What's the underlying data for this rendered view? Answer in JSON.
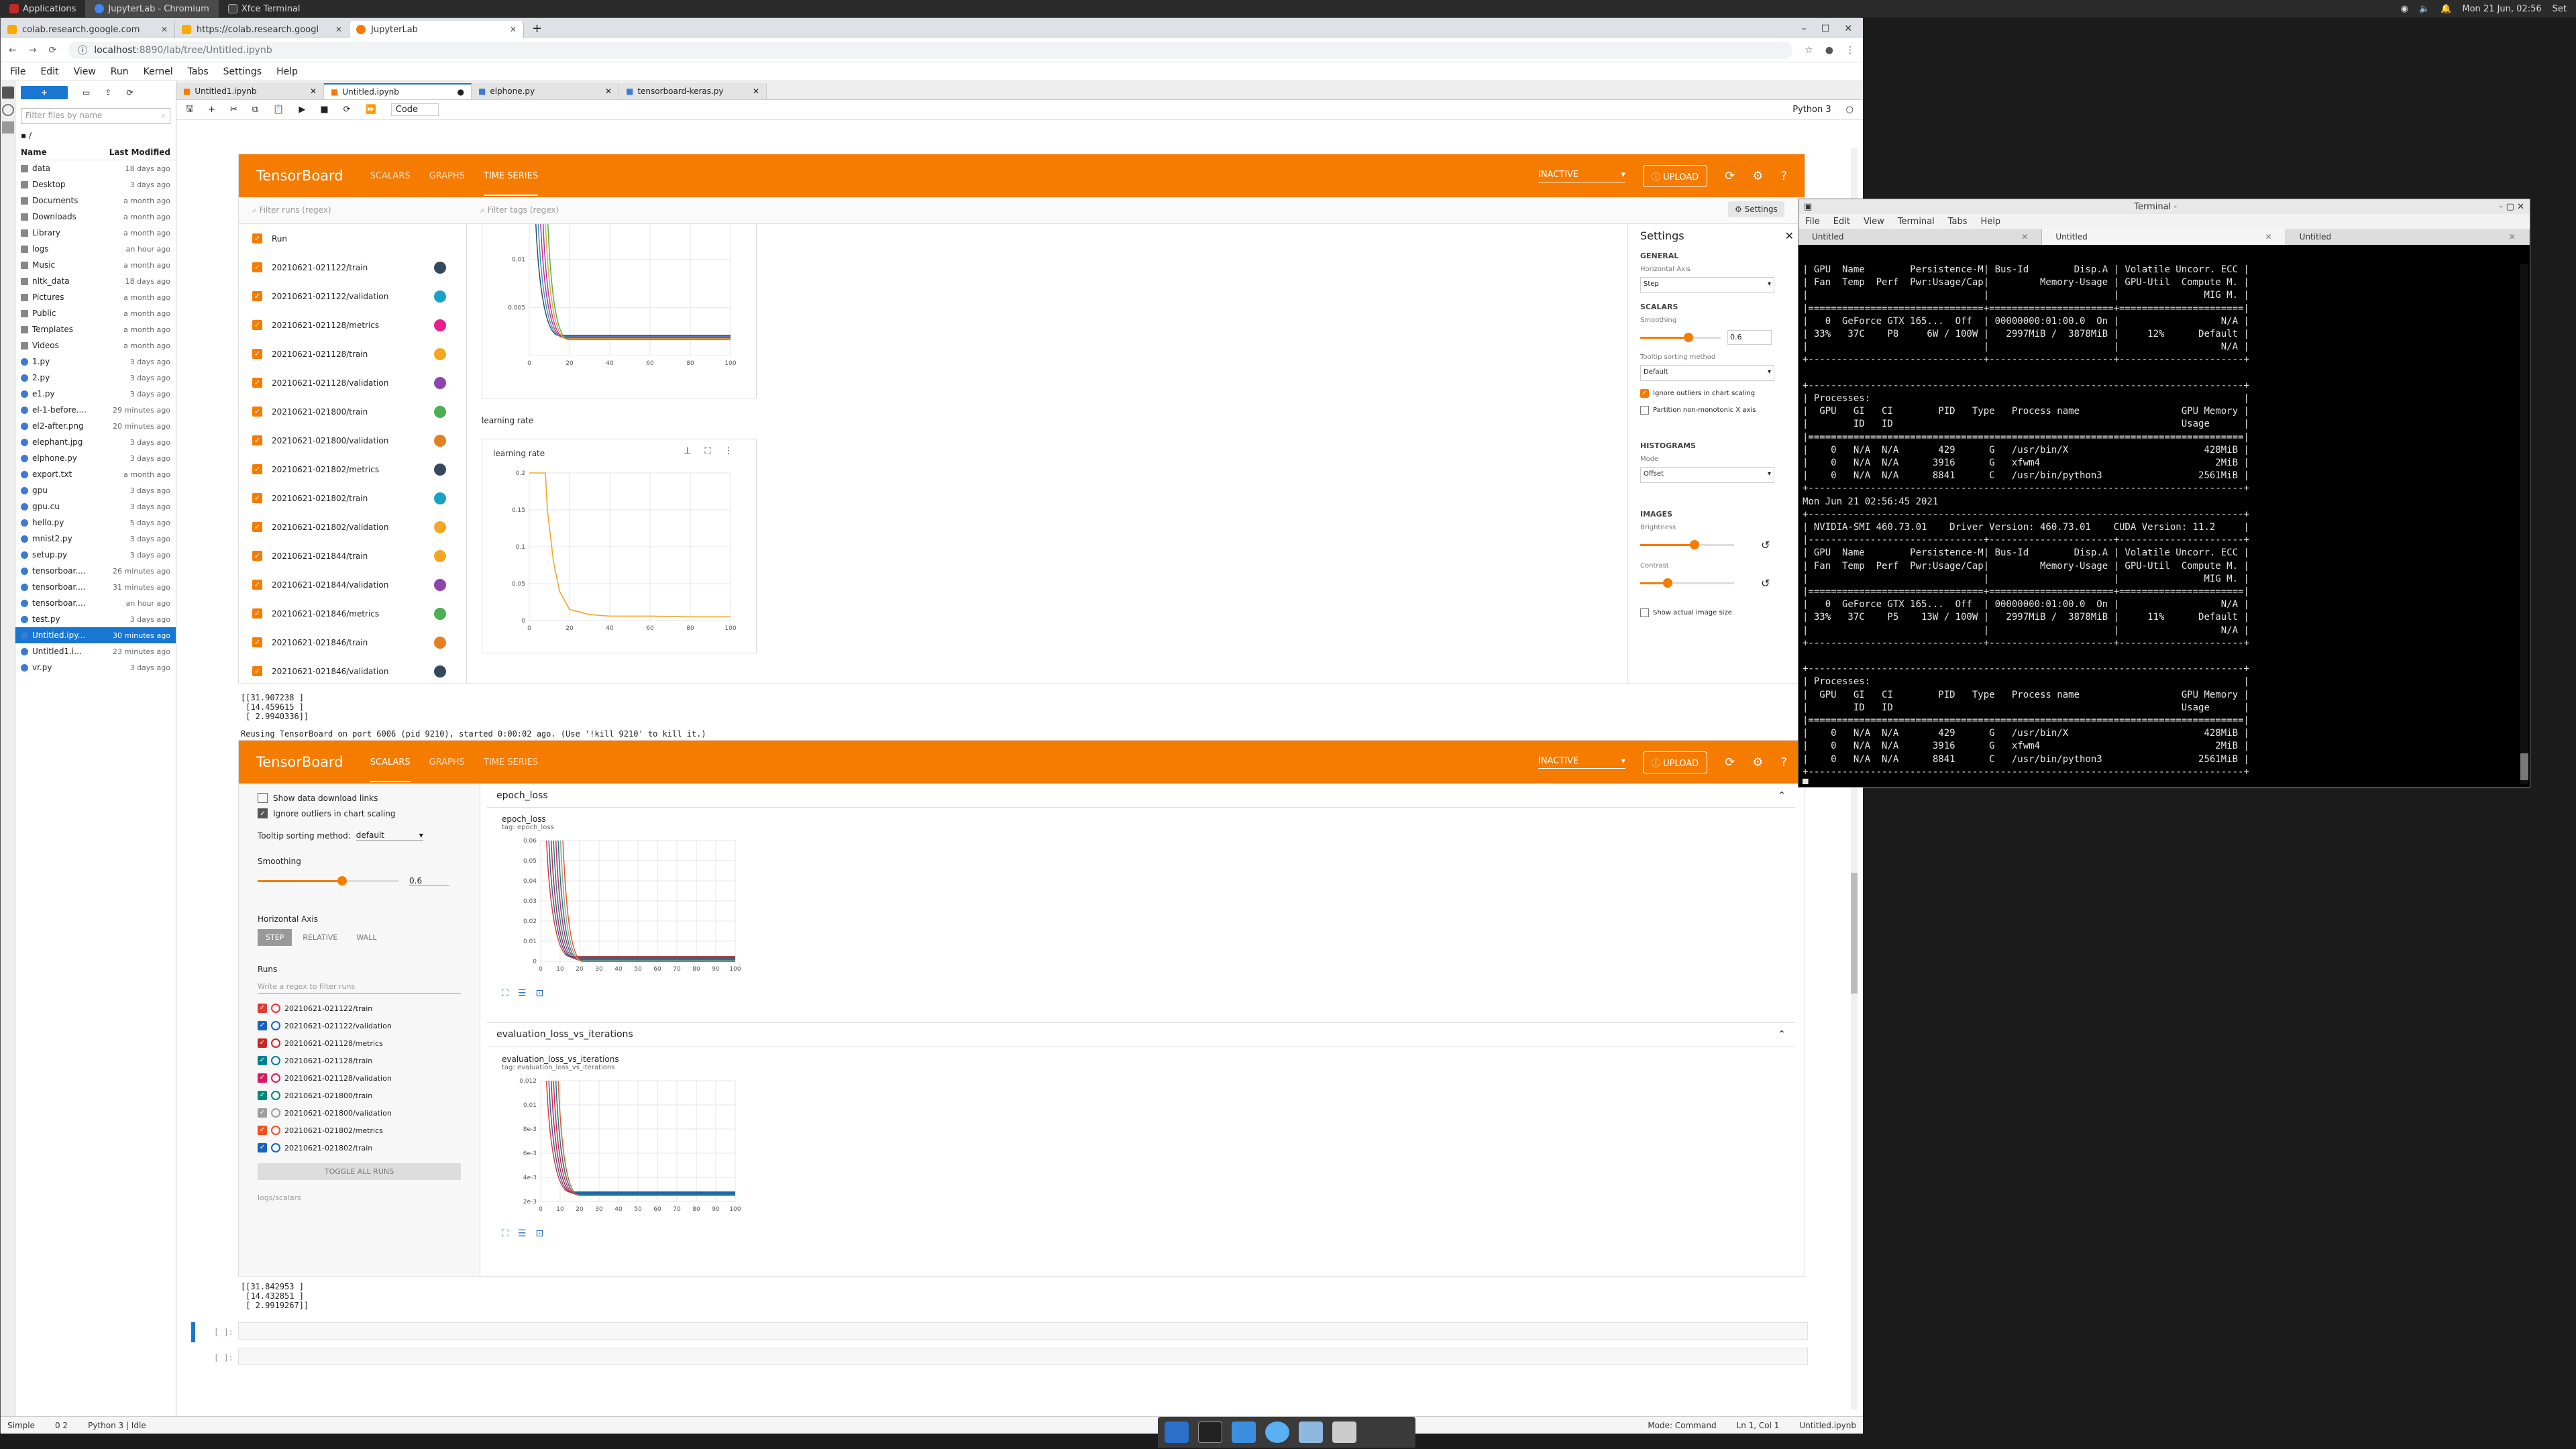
{
  "topbar": {
    "items": [
      "Applications",
      "JupyterLab - Chromium",
      "Xfce Terminal"
    ],
    "clock": "Mon 21 Jun, 02:56",
    "user": "Set"
  },
  "browser": {
    "tabs": [
      {
        "label": "colab.research.google.com"
      },
      {
        "label": "https://colab.research.googl"
      },
      {
        "label": "JupyterLab"
      }
    ],
    "url_host": "localhost",
    "url_path": ":8890/lab/tree/Untitled.ipynb"
  },
  "jupyter": {
    "menu": [
      "File",
      "Edit",
      "View",
      "Run",
      "Kernel",
      "Tabs",
      "Settings",
      "Help"
    ],
    "filter_placeholder": "Filter files by name",
    "path": "/",
    "col_name": "Name",
    "col_modified": "Last Modified",
    "files": [
      {
        "name": "data",
        "date": "18 days ago",
        "type": "folder"
      },
      {
        "name": "Desktop",
        "date": "3 days ago",
        "type": "folder"
      },
      {
        "name": "Documents",
        "date": "a month ago",
        "type": "folder"
      },
      {
        "name": "Downloads",
        "date": "a month ago",
        "type": "folder"
      },
      {
        "name": "Library",
        "date": "a month ago",
        "type": "folder"
      },
      {
        "name": "logs",
        "date": "an hour ago",
        "type": "folder"
      },
      {
        "name": "Music",
        "date": "a month ago",
        "type": "folder"
      },
      {
        "name": "nltk_data",
        "date": "18 days ago",
        "type": "folder"
      },
      {
        "name": "Pictures",
        "date": "a month ago",
        "type": "folder"
      },
      {
        "name": "Public",
        "date": "a month ago",
        "type": "folder"
      },
      {
        "name": "Templates",
        "date": "a month ago",
        "type": "folder"
      },
      {
        "name": "Videos",
        "date": "a month ago",
        "type": "folder"
      },
      {
        "name": "1.py",
        "date": "3 days ago",
        "type": "file"
      },
      {
        "name": "2.py",
        "date": "3 days ago",
        "type": "file"
      },
      {
        "name": "e1.py",
        "date": "3 days ago",
        "type": "file"
      },
      {
        "name": "el-1-before....",
        "date": "29 minutes ago",
        "type": "file"
      },
      {
        "name": "el2-after.png",
        "date": "20 minutes ago",
        "type": "file"
      },
      {
        "name": "elephant.jpg",
        "date": "3 days ago",
        "type": "file"
      },
      {
        "name": "elphone.py",
        "date": "3 days ago",
        "type": "file"
      },
      {
        "name": "export.txt",
        "date": "a month ago",
        "type": "file"
      },
      {
        "name": "gpu",
        "date": "3 days ago",
        "type": "file"
      },
      {
        "name": "gpu.cu",
        "date": "3 days ago",
        "type": "file"
      },
      {
        "name": "hello.py",
        "date": "5 days ago",
        "type": "file"
      },
      {
        "name": "mnist2.py",
        "date": "3 days ago",
        "type": "file"
      },
      {
        "name": "setup.py",
        "date": "3 days ago",
        "type": "file"
      },
      {
        "name": "tensorboar....",
        "date": "26 minutes ago",
        "type": "file"
      },
      {
        "name": "tensorboar....",
        "date": "31 minutes ago",
        "type": "file"
      },
      {
        "name": "tensorboar....",
        "date": "an hour ago",
        "type": "file"
      },
      {
        "name": "test.py",
        "date": "3 days ago",
        "type": "file"
      },
      {
        "name": "Untitled.ipy...",
        "date": "30 minutes ago",
        "type": "file",
        "selected": true
      },
      {
        "name": "Untitled1.i...",
        "date": "23 minutes ago",
        "type": "file"
      },
      {
        "name": "vr.py",
        "date": "3 days ago",
        "type": "file"
      }
    ],
    "doc_tabs": [
      "Untitled1.ipynb",
      "Untitled.ipynb",
      "elphone.py",
      "tensorboard-keras.py"
    ],
    "cell_type": "Code",
    "kernel": "Python 3",
    "status": {
      "mode": "Simple",
      "counts": "0  2",
      "kernel_state": "Python 3 | Idle",
      "mode_cmd": "Mode: Command",
      "cursor": "Ln 1, Col 1",
      "file": "Untitled.ipynb"
    }
  },
  "tb1": {
    "title": "TensorBoard",
    "nav": [
      "SCALARS",
      "GRAPHS",
      "TIME SERIES"
    ],
    "active_nav": "TIME SERIES",
    "inactive": "INACTIVE",
    "upload": "UPLOAD",
    "filter_runs": "Filter runs (regex)",
    "filter_tags": "Filter tags (regex)",
    "settings_btn": "Settings",
    "runs_header": "Run",
    "runs": [
      {
        "name": "20210621-021122/train",
        "color": "#34495e"
      },
      {
        "name": "20210621-021122/validation",
        "color": "#1ba1c6"
      },
      {
        "name": "20210621-021128/metrics",
        "color": "#e91e8c"
      },
      {
        "name": "20210621-021128/train",
        "color": "#f5a623"
      },
      {
        "name": "20210621-021128/validation",
        "color": "#8e44ad"
      },
      {
        "name": "20210621-021800/train",
        "color": "#4caf50"
      },
      {
        "name": "20210621-021800/validation",
        "color": "#e67e22"
      },
      {
        "name": "20210621-021802/metrics",
        "color": "#34495e"
      },
      {
        "name": "20210621-021802/train",
        "color": "#1ba1c6"
      },
      {
        "name": "20210621-021802/validation",
        "color": "#f5a623"
      },
      {
        "name": "20210621-021844/train",
        "color": "#f5a623"
      },
      {
        "name": "20210621-021844/validation",
        "color": "#8e44ad"
      },
      {
        "name": "20210621-021846/metrics",
        "color": "#4caf50"
      },
      {
        "name": "20210621-021846/train",
        "color": "#e67e22"
      },
      {
        "name": "20210621-021846/validation",
        "color": "#34495e"
      }
    ],
    "group_label": "learning rate",
    "card_title": "learning rate",
    "settings": {
      "title": "Settings",
      "general": "GENERAL",
      "h_axis": "Horizontal Axis",
      "h_axis_val": "Step",
      "scalars": "SCALARS",
      "smoothing": "Smoothing",
      "smoothing_val": "0.6",
      "smoothing_level": 0.6,
      "tooltip": "Tooltip sorting method",
      "tooltip_val": "Default",
      "ignore_outliers": "Ignore outliers in chart scaling",
      "partition": "Partition non-monotonic X axis",
      "histograms": "HISTOGRAMS",
      "mode": "Mode",
      "mode_val": "Offset",
      "images": "IMAGES",
      "brightness": "Brightness",
      "contrast": "Contrast",
      "show_actual": "Show actual image size"
    }
  },
  "output1": [
    "[[31.907238 ]",
    " [14.459615 ]",
    " [ 2.9940336]]"
  ],
  "reuse_msg": "Reusing TensorBoard on port 6006 (pid 9210), started 0:00:02 ago. (Use '!kill 9210' to kill it.)",
  "tb2": {
    "title": "TensorBoard",
    "nav": [
      "SCALARS",
      "GRAPHS",
      "TIME SERIES"
    ],
    "active_nav": "SCALARS",
    "inactive": "INACTIVE",
    "upload": "UPLOAD",
    "show_download": "Show data download links",
    "ignore_outliers": "Ignore outliers in chart scaling",
    "tooltip_label": "Tooltip sorting method:",
    "tooltip_val": "default",
    "smoothing": "Smoothing",
    "smoothing_val": "0.6",
    "smoothing_level": 0.6,
    "h_axis": "Horizontal Axis",
    "h_opts": [
      "STEP",
      "RELATIVE",
      "WALL"
    ],
    "runs_label": "Runs",
    "runs_filter": "Write a regex to filter runs",
    "runs": [
      {
        "name": "20210621-021122/train",
        "color": "#e53935"
      },
      {
        "name": "20210621-021122/validation",
        "color": "#1565c0"
      },
      {
        "name": "20210621-021128/metrics",
        "color": "#c62828"
      },
      {
        "name": "20210621-021128/train",
        "color": "#00838f"
      },
      {
        "name": "20210621-021128/validation",
        "color": "#d81b60"
      },
      {
        "name": "20210621-021800/train",
        "color": "#00897b"
      },
      {
        "name": "20210621-021800/validation",
        "color": "#9e9e9e"
      },
      {
        "name": "20210621-021802/metrics",
        "color": "#f4511e"
      },
      {
        "name": "20210621-021802/train",
        "color": "#1565c0"
      }
    ],
    "toggle_all": "TOGGLE ALL RUNS",
    "logdir": "logs/scalars",
    "sec1": "epoch_loss",
    "chart1_title": "epoch_loss",
    "chart1_tag": "tag: epoch_loss",
    "sec2": "evaluation_loss_vs_iterations",
    "chart2_title": "evaluation_loss_vs_iterations",
    "chart2_tag": "tag: evaluation_loss_vs_iterations"
  },
  "output2": [
    "[[31.842953 ]",
    " [14.432851 ]",
    " [ 2.9919267]]"
  ],
  "cell_prompts": [
    "[ ]:",
    "[ ]:"
  ],
  "terminal": {
    "title": "Terminal -",
    "menu": [
      "File",
      "Edit",
      "View",
      "Terminal",
      "Tabs",
      "Help"
    ],
    "tabs": [
      "Untitled",
      "Untitled",
      "Untitled"
    ],
    "lines": [
      "| GPU  Name        Persistence-M| Bus-Id        Disp.A | Volatile Uncorr. ECC |",
      "| Fan  Temp  Perf  Pwr:Usage/Cap|         Memory-Usage | GPU-Util  Compute M. |",
      "|                               |                      |               MIG M. |",
      "|===============================+======================+======================|",
      "|   0  GeForce GTX 165...  Off  | 00000000:01:00.0  On |                  N/A |",
      "| 33%   37C    P8     6W / 100W |   2997MiB /  3878MiB |     12%      Default |",
      "|                               |                      |                  N/A |",
      "+-------------------------------+----------------------+----------------------+",
      "",
      "+-----------------------------------------------------------------------------+",
      "| Processes:                                                                  |",
      "|  GPU   GI   CI        PID   Type   Process name                  GPU Memory |",
      "|        ID   ID                                                   Usage      |",
      "|=============================================================================|",
      "|    0   N/A  N/A       429      G   /usr/bin/X                        428MiB |",
      "|    0   N/A  N/A      3916      G   xfwm4                               2MiB |",
      "|    0   N/A  N/A      8841      C   /usr/bin/python3                 2561MiB |",
      "+-----------------------------------------------------------------------------+",
      "Mon Jun 21 02:56:45 2021",
      "+-----------------------------------------------------------------------------+",
      "| NVIDIA-SMI 460.73.01    Driver Version: 460.73.01    CUDA Version: 11.2     |",
      "|-------------------------------+----------------------+----------------------+",
      "| GPU  Name        Persistence-M| Bus-Id        Disp.A | Volatile Uncorr. ECC |",
      "| Fan  Temp  Perf  Pwr:Usage/Cap|         Memory-Usage | GPU-Util  Compute M. |",
      "|                               |                      |               MIG M. |",
      "|===============================+======================+======================|",
      "|   0  GeForce GTX 165...  Off  | 00000000:01:00.0  On |                  N/A |",
      "| 33%   37C    P5    13W / 100W |   2997MiB /  3878MiB |     11%      Default |",
      "|                               |                      |                  N/A |",
      "+-------------------------------+----------------------+----------------------+",
      "",
      "+-----------------------------------------------------------------------------+",
      "| Processes:                                                                  |",
      "|  GPU   GI   CI        PID   Type   Process name                  GPU Memory |",
      "|        ID   ID                                                   Usage      |",
      "|=============================================================================|",
      "|    0   N/A  N/A       429      G   /usr/bin/X                        428MiB |",
      "|    0   N/A  N/A      3916      G   xfwm4                               2MiB |",
      "|    0   N/A  N/A      8841      C   /usr/bin/python3                 2561MiB |",
      "+-----------------------------------------------------------------------------+",
      "█"
    ]
  },
  "chart_data": [
    {
      "type": "line",
      "title": "",
      "x_ticks": [
        "0",
        "20",
        "40",
        "60",
        "80",
        "100"
      ],
      "y_ticks": [
        "0.005",
        "0.01"
      ],
      "xlim": [
        0,
        100
      ],
      "note": "top portion of chart scrolled out of view"
    },
    {
      "type": "line",
      "title": "learning rate",
      "x": [
        0,
        8,
        9,
        12,
        15,
        20,
        30,
        40,
        60,
        80,
        100
      ],
      "series": [
        {
          "values": [
            0.2,
            0.2,
            0.15,
            0.08,
            0.04,
            0.015,
            0.008,
            0.006,
            0.006,
            0.005,
            0.005
          ],
          "color": "#f5a623"
        }
      ],
      "x_ticks": [
        "0",
        "20",
        "40",
        "60",
        "80",
        "100"
      ],
      "y_ticks": [
        "0",
        "0.05",
        "0.1",
        "0.15",
        "0.2"
      ],
      "xlim": [
        0,
        100
      ],
      "ylim": [
        0,
        0.2
      ]
    },
    {
      "type": "line",
      "title": "epoch_loss",
      "x_ticks": [
        "0",
        "10",
        "20",
        "30",
        "40",
        "50",
        "60",
        "70",
        "80",
        "90",
        "100"
      ],
      "y_ticks": [
        "0",
        "0.01",
        "0.02",
        "0.03",
        "0.04",
        "0.05",
        "0.06"
      ],
      "xlim": [
        0,
        100
      ],
      "ylim": [
        0,
        0.06
      ]
    },
    {
      "type": "line",
      "title": "evaluation_loss_vs_iterations",
      "x_ticks": [
        "0",
        "10",
        "20",
        "30",
        "40",
        "50",
        "60",
        "70",
        "80",
        "90",
        "100"
      ],
      "y_ticks": [
        "2e-3",
        "4e-3",
        "6e-3",
        "8e-3",
        "0.01",
        "0.012"
      ],
      "xlim": [
        0,
        100
      ],
      "ylim": [
        0.002,
        0.012
      ]
    }
  ]
}
